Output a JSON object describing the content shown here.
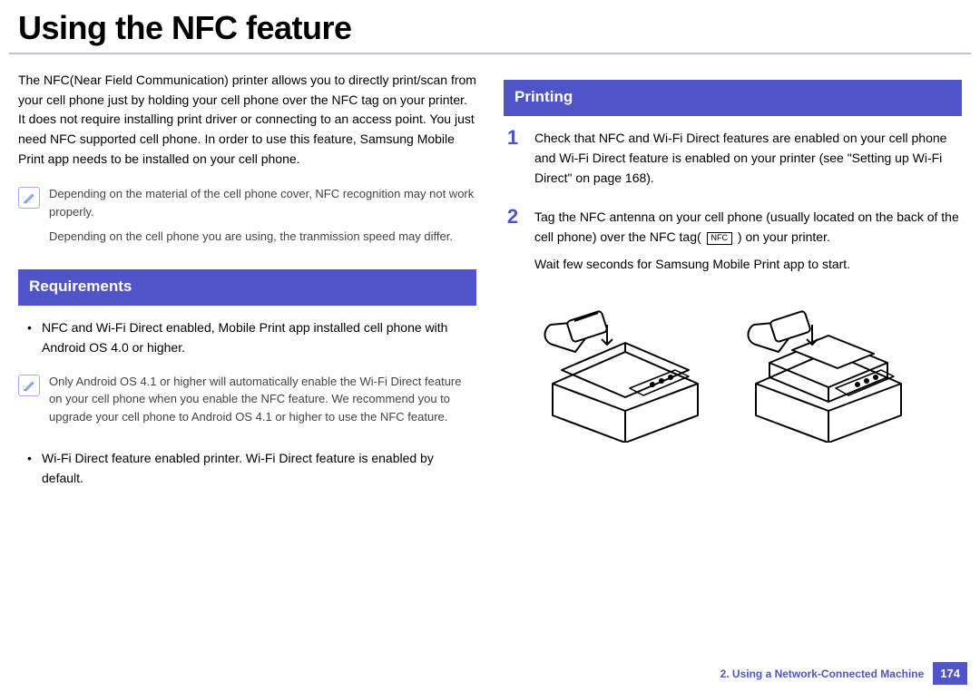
{
  "title": "Using the NFC feature",
  "intro": "The NFC(Near Field Communication) printer allows you to directly print/scan from your cell phone just by holding your cell phone over the NFC tag on your printer. It does not require installing print driver or connecting to an access point. You just need NFC supported cell phone. In order to use this feature, Samsung Mobile Print app needs to be installed on your cell phone.",
  "note1": {
    "p1": "Depending on the material of the cell phone cover, NFC recognition may not work properly.",
    "p2": "Depending on the cell phone you are using, the tranmission speed may differ."
  },
  "sections": {
    "requirements": {
      "header": "Requirements",
      "bullet1": "NFC and Wi-Fi Direct enabled, Mobile Print app installed cell phone with Android OS 4.0 or higher.",
      "note": "Only Android OS 4.1 or higher will automatically enable the Wi-Fi Direct feature on your cell phone when you enable the NFC feature. We recommend you to upgrade your cell phone to Android OS 4.1 or higher to use the NFC feature.",
      "bullet2": "Wi-Fi Direct feature enabled printer. Wi-Fi Direct feature is enabled by default."
    },
    "printing": {
      "header": "Printing",
      "step1": "Check that NFC and Wi-Fi Direct features are enabled on your cell phone and Wi-Fi Direct feature is enabled on your printer (see \"Setting up Wi-Fi Direct\" on page 168).",
      "step2a": "Tag the NFC antenna on your cell phone (usually located on the back of the cell phone) over the NFC tag(",
      "step2b": ") on your printer.",
      "step2c": "Wait few seconds for Samsung Mobile Print app to start.",
      "nfc_label": "NFC"
    }
  },
  "footer": {
    "chapter": "2.  Using a Network-Connected Machine",
    "page": "174"
  }
}
